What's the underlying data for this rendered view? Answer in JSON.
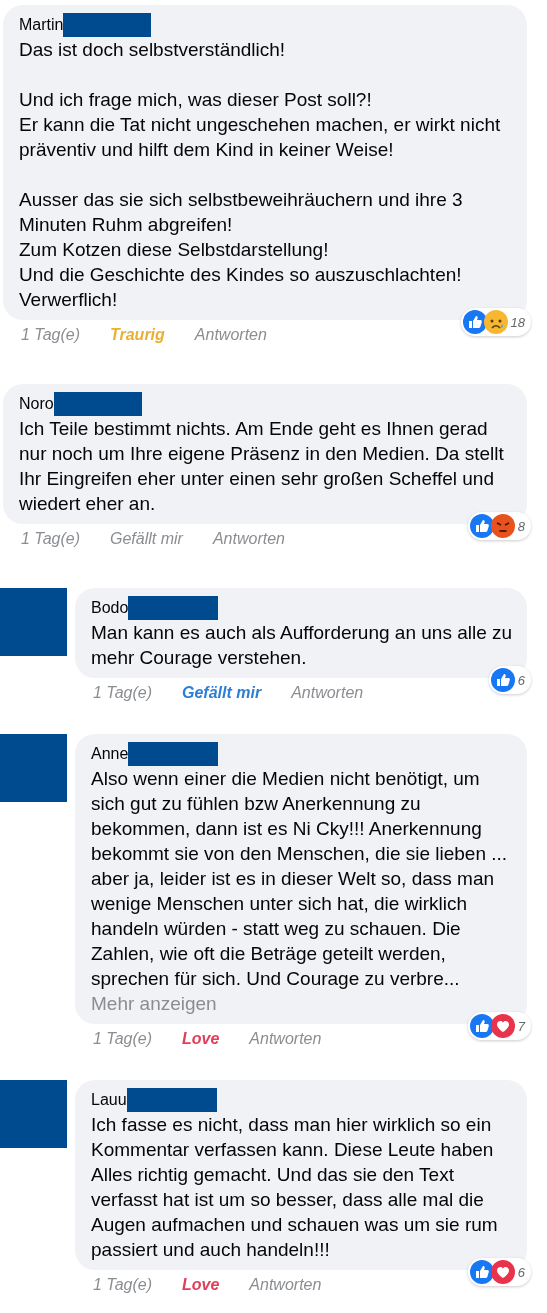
{
  "comments": [
    {
      "kind": "comment",
      "author": "Martin",
      "paragraphs": [
        "Das ist doch selbstverständlich!",
        "Und ich frage mich, was dieser Post soll?!\nEr kann die Tat nicht ungeschehen machen, er wirkt nicht präventiv und hilft dem Kind in keiner Weise!",
        "Ausser das sie sich selbstbeweihräuchern und ihre 3 Minuten Ruhm abgreifen!\nZum Kotzen diese Selbstdarstellung!\nUnd die Geschichte des Kindes so auszuschlachten!\nVerwerflich!"
      ],
      "time": "1 Tag(e)",
      "reaction": {
        "label": "Traurig",
        "selected": true,
        "color": "#e9b032"
      },
      "reply": "Antworten",
      "reactions": [
        {
          "kind": "like"
        },
        {
          "kind": "sad"
        }
      ],
      "count": "18"
    },
    {
      "kind": "comment",
      "author": "Noro",
      "paragraphs": [
        "Ich Teile bestimmt nichts. Am Ende geht es Ihnen gerad nur noch um Ihre eigene Präsenz in den Medien. Da stellt Ihr Eingreifen eher unter einen sehr großen Scheffel und wiedert eher an."
      ],
      "time": "1 Tag(e)",
      "reaction": {
        "label": "Gefällt mir",
        "selected": false,
        "color": "#8a8d91"
      },
      "reply": "Antworten",
      "reactions": [
        {
          "kind": "like"
        },
        {
          "kind": "angry"
        }
      ],
      "count": "8"
    },
    {
      "kind": "reply",
      "author": "Bodo",
      "paragraphs": [
        "Man kann es auch als Aufforderung an uns alle zu mehr Courage verstehen."
      ],
      "time": "1 Tag(e)",
      "reaction": {
        "label": "Gefällt mir",
        "selected": true,
        "color": "#2d7fd6"
      },
      "reply": "Antworten",
      "reactions": [
        {
          "kind": "like"
        }
      ],
      "count": "6"
    },
    {
      "kind": "reply",
      "author": "Anne",
      "paragraphs": [
        "Also wenn einer die Medien nicht benötigt, um sich gut zu fühlen bzw Anerkennung zu bekommen, dann ist es Ni Cky!!! Anerkennung bekommt sie von den Menschen, die sie lieben ... aber ja, leider ist es in dieser Welt so, dass man wenige Menschen unter sich hat, die wirklich handeln würden - statt weg zu schauen. Die Zahlen, wie oft die Beträge geteilt werden, sprechen für sich. Und Courage zu verbre..."
      ],
      "more": "Mehr anzeigen",
      "time": "1 Tag(e)",
      "reaction": {
        "label": "Love",
        "selected": true,
        "color": "#e0405a"
      },
      "reply": "Antworten",
      "reactions": [
        {
          "kind": "like"
        },
        {
          "kind": "love"
        }
      ],
      "count": "7"
    },
    {
      "kind": "reply",
      "author": "Lauu",
      "paragraphs": [
        "Ich fasse es nicht, dass man hier wirklich so ein Kommentar verfassen kann. Diese Leute haben Alles richtig gemacht. Und das sie den Text verfasst hat ist um so besser, dass alle mal die Augen aufmachen und schauen was um sie rum passiert und auch handeln!!!"
      ],
      "time": "1 Tag(e)",
      "reaction": {
        "label": "Love",
        "selected": true,
        "color": "#e0405a"
      },
      "reply": "Antworten",
      "reactions": [
        {
          "kind": "like"
        },
        {
          "kind": "love"
        }
      ],
      "count": "6"
    }
  ]
}
